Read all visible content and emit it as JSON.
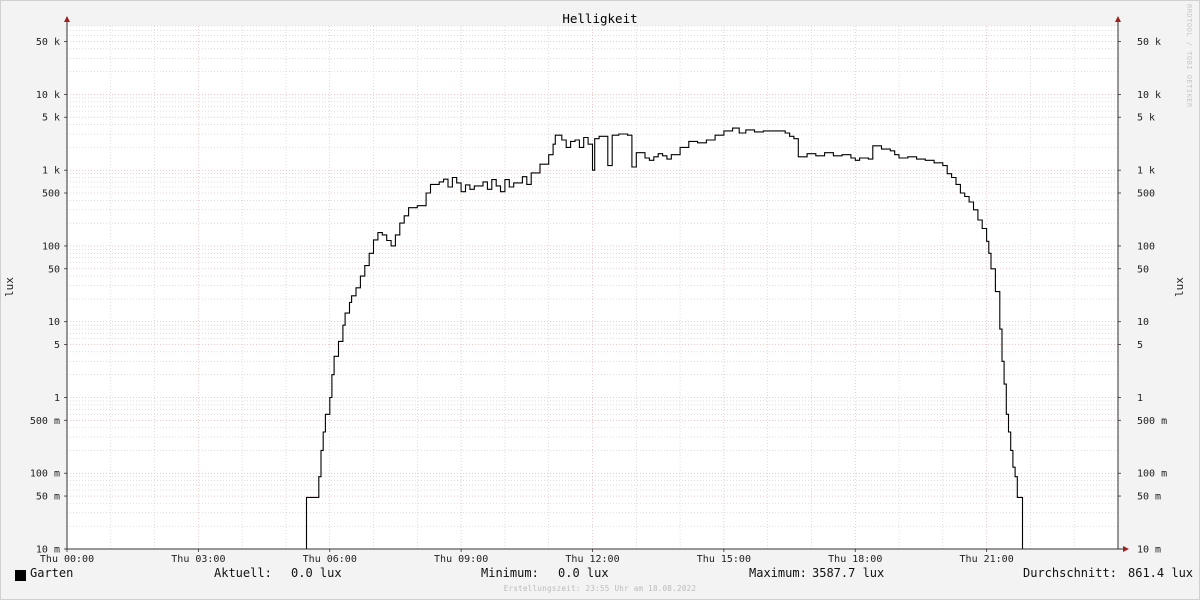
{
  "chart_data": {
    "type": "line",
    "title": "Helligkeit",
    "ylabel": "lux",
    "y_scale": "log",
    "ylim": [
      0.01,
      80000
    ],
    "y_ticks": [
      {
        "v": 50000,
        "label": "50 k"
      },
      {
        "v": 10000,
        "label": "10 k"
      },
      {
        "v": 5000,
        "label": "5 k"
      },
      {
        "v": 1000,
        "label": "1 k"
      },
      {
        "v": 500,
        "label": "500"
      },
      {
        "v": 100,
        "label": "100"
      },
      {
        "v": 50,
        "label": "50"
      },
      {
        "v": 10,
        "label": "10"
      },
      {
        "v": 5,
        "label": "5"
      },
      {
        "v": 1,
        "label": "1"
      },
      {
        "v": 0.5,
        "label": "500 m"
      },
      {
        "v": 0.1,
        "label": "100 m"
      },
      {
        "v": 0.05,
        "label": "50 m"
      },
      {
        "v": 0.01,
        "label": "10 m"
      }
    ],
    "xlim_hours": [
      0,
      24
    ],
    "x_ticks": [
      {
        "h": 0,
        "label": "Thu 00:00"
      },
      {
        "h": 3,
        "label": "Thu 03:00"
      },
      {
        "h": 6,
        "label": "Thu 06:00"
      },
      {
        "h": 9,
        "label": "Thu 09:00"
      },
      {
        "h": 12,
        "label": "Thu 12:00"
      },
      {
        "h": 15,
        "label": "Thu 15:00"
      },
      {
        "h": 18,
        "label": "Thu 18:00"
      },
      {
        "h": 21,
        "label": "Thu 21:00"
      }
    ],
    "grid": true,
    "line_color": "#000000",
    "major_grid_color": "#e8a8a8",
    "minor_grid_color": "#c8c8c8",
    "series": [
      {
        "name": "Garten",
        "points": [
          [
            0.0,
            0.0
          ],
          [
            5.45,
            0.0
          ],
          [
            5.47,
            0.048
          ],
          [
            5.7,
            0.048
          ],
          [
            5.75,
            0.09
          ],
          [
            5.8,
            0.2
          ],
          [
            5.85,
            0.35
          ],
          [
            5.9,
            0.6
          ],
          [
            6.0,
            1.0
          ],
          [
            6.05,
            2.0
          ],
          [
            6.1,
            3.5
          ],
          [
            6.2,
            5.5
          ],
          [
            6.3,
            9.0
          ],
          [
            6.35,
            13
          ],
          [
            6.45,
            18
          ],
          [
            6.5,
            22
          ],
          [
            6.6,
            28
          ],
          [
            6.7,
            40
          ],
          [
            6.8,
            55
          ],
          [
            6.9,
            80
          ],
          [
            7.0,
            120
          ],
          [
            7.1,
            150
          ],
          [
            7.2,
            140
          ],
          [
            7.3,
            118
          ],
          [
            7.4,
            100
          ],
          [
            7.5,
            140
          ],
          [
            7.6,
            200
          ],
          [
            7.7,
            250
          ],
          [
            7.8,
            320
          ],
          [
            8.0,
            340
          ],
          [
            8.2,
            500
          ],
          [
            8.3,
            650
          ],
          [
            8.5,
            700
          ],
          [
            8.6,
            760
          ],
          [
            8.7,
            600
          ],
          [
            8.8,
            800
          ],
          [
            8.9,
            680
          ],
          [
            9.0,
            520
          ],
          [
            9.1,
            640
          ],
          [
            9.2,
            560
          ],
          [
            9.3,
            620
          ],
          [
            9.5,
            700
          ],
          [
            9.6,
            560
          ],
          [
            9.7,
            750
          ],
          [
            9.8,
            620
          ],
          [
            9.9,
            520
          ],
          [
            10.0,
            750
          ],
          [
            10.1,
            600
          ],
          [
            10.2,
            680
          ],
          [
            10.4,
            820
          ],
          [
            10.5,
            650
          ],
          [
            10.6,
            920
          ],
          [
            10.8,
            1200
          ],
          [
            11.0,
            1600
          ],
          [
            11.1,
            2200
          ],
          [
            11.15,
            2900
          ],
          [
            11.3,
            2500
          ],
          [
            11.4,
            2000
          ],
          [
            11.5,
            2400
          ],
          [
            11.6,
            2500
          ],
          [
            11.7,
            2000
          ],
          [
            11.8,
            2700
          ],
          [
            11.9,
            2200
          ],
          [
            12.0,
            1000
          ],
          [
            12.05,
            2600
          ],
          [
            12.15,
            2800
          ],
          [
            12.35,
            1150
          ],
          [
            12.45,
            2900
          ],
          [
            12.6,
            3000
          ],
          [
            12.8,
            2900
          ],
          [
            12.9,
            1100
          ],
          [
            13.0,
            1700
          ],
          [
            13.2,
            1450
          ],
          [
            13.3,
            1350
          ],
          [
            13.4,
            1500
          ],
          [
            13.5,
            1650
          ],
          [
            13.6,
            1550
          ],
          [
            13.7,
            1400
          ],
          [
            13.8,
            1600
          ],
          [
            14.0,
            2000
          ],
          [
            14.2,
            2400
          ],
          [
            14.4,
            2300
          ],
          [
            14.6,
            2500
          ],
          [
            14.8,
            2900
          ],
          [
            15.0,
            3300
          ],
          [
            15.2,
            3587.7
          ],
          [
            15.35,
            3100
          ],
          [
            15.5,
            3400
          ],
          [
            15.7,
            3200
          ],
          [
            15.9,
            3300
          ],
          [
            16.2,
            3300
          ],
          [
            16.4,
            3100
          ],
          [
            16.5,
            2800
          ],
          [
            16.6,
            2600
          ],
          [
            16.7,
            1500
          ],
          [
            16.9,
            1650
          ],
          [
            17.1,
            1550
          ],
          [
            17.3,
            1700
          ],
          [
            17.5,
            1550
          ],
          [
            17.7,
            1600
          ],
          [
            17.9,
            1450
          ],
          [
            18.0,
            1350
          ],
          [
            18.1,
            1450
          ],
          [
            18.3,
            1400
          ],
          [
            18.4,
            2100
          ],
          [
            18.6,
            1900
          ],
          [
            18.8,
            1800
          ],
          [
            18.9,
            1600
          ],
          [
            19.0,
            1450
          ],
          [
            19.2,
            1500
          ],
          [
            19.4,
            1400
          ],
          [
            19.6,
            1350
          ],
          [
            19.8,
            1250
          ],
          [
            20.0,
            1150
          ],
          [
            20.1,
            900
          ],
          [
            20.2,
            800
          ],
          [
            20.3,
            650
          ],
          [
            20.4,
            500
          ],
          [
            20.5,
            450
          ],
          [
            20.6,
            380
          ],
          [
            20.7,
            300
          ],
          [
            20.8,
            220
          ],
          [
            20.9,
            170
          ],
          [
            21.0,
            115
          ],
          [
            21.05,
            80
          ],
          [
            21.1,
            50
          ],
          [
            21.2,
            25
          ],
          [
            21.3,
            8
          ],
          [
            21.35,
            3
          ],
          [
            21.4,
            1.5
          ],
          [
            21.45,
            0.6
          ],
          [
            21.5,
            0.35
          ],
          [
            21.55,
            0.2
          ],
          [
            21.6,
            0.12
          ],
          [
            21.65,
            0.09
          ],
          [
            21.7,
            0.048
          ],
          [
            21.8,
            0.048
          ],
          [
            21.82,
            0.0
          ],
          [
            24.0,
            0.0
          ]
        ]
      }
    ]
  },
  "watermark": "RRDTOOL / TOBI OETIKER",
  "legend": {
    "series_name": "Garten",
    "swatch_color": "#000000",
    "current_label": "Aktuell:",
    "current_value": "0.0 lux",
    "min_label": "Minimum:",
    "min_value": "0.0 lux",
    "max_label": "Maximum:",
    "max_value": "3587.7 lux",
    "avg_label": "Durchschnitt:",
    "avg_value": "861.4 lux"
  },
  "footer": "Erstellungszeit: 23:55 Uhr am 18.08.2022"
}
